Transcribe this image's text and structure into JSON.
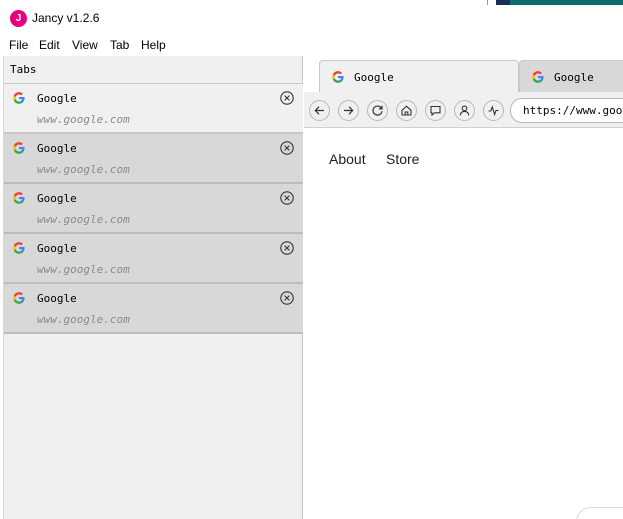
{
  "window": {
    "app_icon_letter": "J",
    "title": "Jancy v1.2.6",
    "accent_color": "#e6007e"
  },
  "menubar": {
    "items": [
      "File",
      "Edit",
      "View",
      "Tab",
      "Help"
    ]
  },
  "sidebar": {
    "header": "Tabs",
    "tabs": [
      {
        "title": "Google",
        "url": "www.google.com",
        "active": true
      },
      {
        "title": "Google",
        "url": "www.google.com",
        "active": false
      },
      {
        "title": "Google",
        "url": "www.google.com",
        "active": false
      },
      {
        "title": "Google",
        "url": "www.google.com",
        "active": false
      },
      {
        "title": "Google",
        "url": "www.google.com",
        "active": false
      }
    ]
  },
  "browser": {
    "tabs": [
      {
        "title": "Google",
        "active": true
      },
      {
        "title": "Google",
        "active": false
      }
    ],
    "nav_icons": [
      "back-arrow-icon",
      "forward-arrow-icon",
      "reload-icon",
      "home-icon",
      "chat-icon",
      "user-icon",
      "activity-icon"
    ],
    "url": "https://www.google.com",
    "page": {
      "links": [
        "About",
        "Store"
      ]
    }
  }
}
